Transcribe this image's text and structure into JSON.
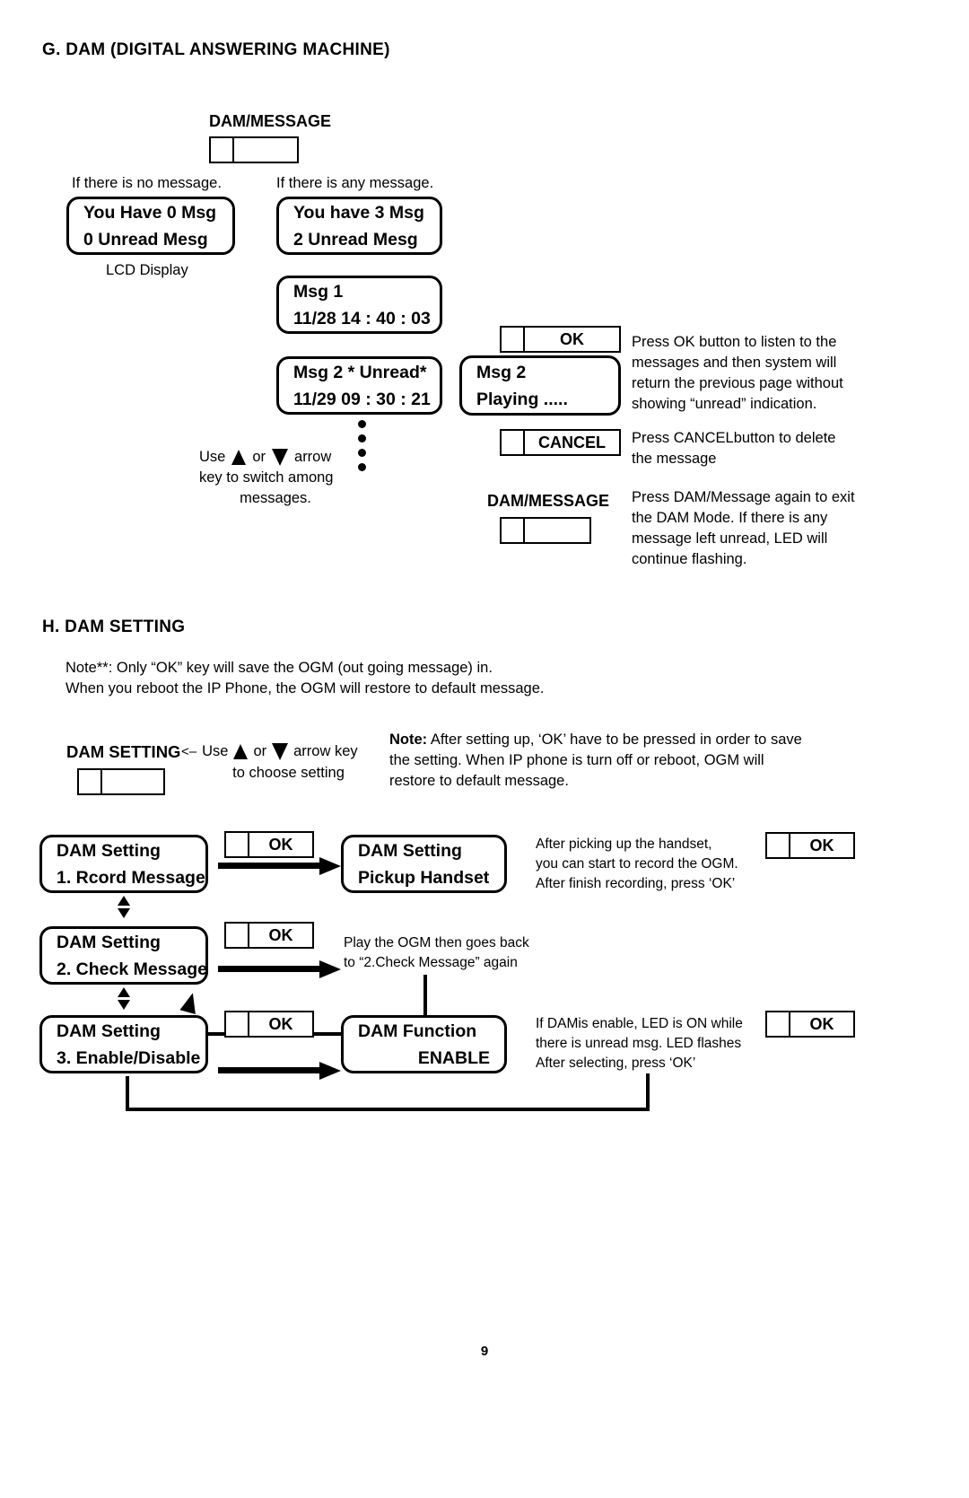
{
  "page": {
    "number": "9"
  },
  "section_g": {
    "heading": "G. DAM (DIGITAL ANSWERING MACHINE)",
    "dam_message_key_label": "DAM/MESSAGE",
    "no_message_caption": "If there is no message.",
    "any_message_caption": "If there is any message.",
    "lcd_display_caption": "LCD Display",
    "lcd_no_message": {
      "line1": "You Have 0 Msg",
      "line2": "0 Unread Mesg"
    },
    "lcd_any_message": {
      "line1": "You have 3 Msg",
      "line2": "2 Unread Mesg"
    },
    "lcd_msg1": {
      "line1": "Msg 1",
      "line2": "11/28 14 : 40 : 03"
    },
    "lcd_msg2": {
      "line1": "Msg 2 * Unread*",
      "line2": "11/29 09 : 30 : 21"
    },
    "lcd_playing": {
      "line1": "Msg 2",
      "line2": "Playing ....."
    },
    "arrow_hint": {
      "prefix": "Use",
      "middle": "or",
      "suffix": "arrow",
      "line2": "key to switch among",
      "line3": "messages."
    },
    "ok_key_label": "OK",
    "cancel_key_label": "CANCEL",
    "dam_message_key_label_2": "DAM/MESSAGE",
    "ok_description": "Press OK button to listen to the\nmessages and then system will\nreturn the previous page without\nshowing  “unread” indication.",
    "cancel_description": "Press CANCELbutton to delete\nthe message",
    "dam_exit_description": "Press DAM/Message again to exit\nthe DAM Mode. If there is any\nmessage left unread, LED will\ncontinue flashing."
  },
  "section_h": {
    "heading": "H. DAM SETTING",
    "note_star": "Note**: Only “OK” key will save the OGM (out going message) in.\nWhen you reboot the IP Phone, the OGM will restore to default message.",
    "dam_setting_key_label": "DAM SETTING",
    "choose_hint": {
      "arrow_in": "<–",
      "prefix": "Use",
      "middle": "or",
      "suffix": "arrow key",
      "line2": "to choose setting"
    },
    "note_block": {
      "lead": "Note:",
      "text": " After setting up, ‘OK’ have to be pressed in order to save\nthe setting. When IP phone is turn off or reboot, OGM will\nrestore to default message."
    },
    "ok_key_label": "OK",
    "rows": [
      {
        "left_lcd": {
          "line1": "DAM Setting",
          "line2": "1. Rcord Message"
        },
        "key_label": "OK",
        "right_lcd": {
          "line1": "DAM Setting",
          "line2": "Pickup Handset"
        },
        "description": "After picking up the handset,\nyou can start to record the OGM.\nAfter finish recording, press ‘OK’",
        "far_key_label": "OK"
      },
      {
        "left_lcd": {
          "line1": "DAM Setting",
          "line2": "2. Check Message"
        },
        "key_label": "OK",
        "description": "Play the OGM then goes back\nto “2.Check Message” again"
      },
      {
        "left_lcd": {
          "line1": "DAM Setting",
          "line2": "3. Enable/Disable"
        },
        "key_label": "OK",
        "right_lcd": {
          "line1": "DAM Function",
          "line2": "ENABLE"
        },
        "description": "If DAMis enable, LED is ON while\nthere is unread msg. LED flashes\nAfter selecting, press ‘OK’",
        "far_key_label": "OK"
      }
    ]
  }
}
